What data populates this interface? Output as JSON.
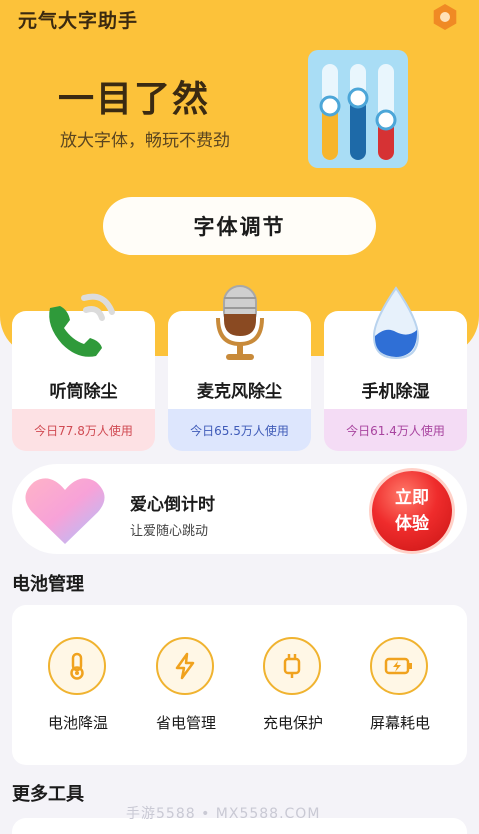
{
  "app": {
    "title": "元气大字助手"
  },
  "hero": {
    "headline": "一目了然",
    "subtitle": "放大字体，畅玩不费劲",
    "font_adjust_label": "字体调节"
  },
  "tools": [
    {
      "label": "听筒除尘",
      "usage": "今日77.8万人使用",
      "icon": "phone-icon"
    },
    {
      "label": "麦克风除尘",
      "usage": "今日65.5万人使用",
      "icon": "microphone-icon"
    },
    {
      "label": "手机除湿",
      "usage": "今日61.4万人使用",
      "icon": "water-drop-icon"
    }
  ],
  "love": {
    "title": "爱心倒计时",
    "subtitle": "让爱随心跳动",
    "button_line1": "立即",
    "button_line2": "体验"
  },
  "battery": {
    "title": "电池管理",
    "items": [
      {
        "label": "电池降温",
        "icon": "thermometer-icon"
      },
      {
        "label": "省电管理",
        "icon": "lightning-icon"
      },
      {
        "label": "充电保护",
        "icon": "charger-icon"
      },
      {
        "label": "屏幕耗电",
        "icon": "battery-charging-icon"
      }
    ]
  },
  "more": {
    "title": "更多工具"
  },
  "watermark": "手游5588 • MX5588.COM",
  "colors": {
    "accent": "#fcc23a",
    "icon_orange": "#f0b330",
    "button_red": "#ef2c2c"
  }
}
